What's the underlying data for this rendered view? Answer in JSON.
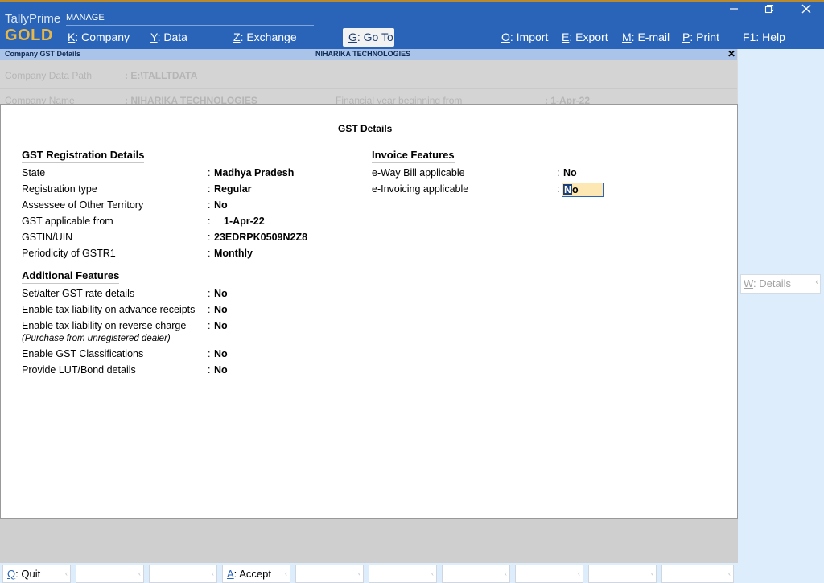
{
  "app": {
    "brand_name": "TallyPrime",
    "brand_edition": "GOLD",
    "section_label": "MANAGE",
    "window_controls": [
      "minimize-icon",
      "restore-icon",
      "close-icon"
    ]
  },
  "menu": {
    "company": {
      "key": "K",
      "label": "Company"
    },
    "data": {
      "key": "Y",
      "label": "Data"
    },
    "exchange": {
      "key": "Z",
      "label": "Exchange"
    },
    "goto": {
      "key": "G",
      "label": "Go To"
    },
    "import": {
      "key": "O",
      "label": "Import"
    },
    "export": {
      "key": "E",
      "label": "Export"
    },
    "email": {
      "key": "M",
      "label": "E-mail"
    },
    "print": {
      "key": "P",
      "label": "Print"
    },
    "help": {
      "key": "F1",
      "label": "Help"
    }
  },
  "subbar": {
    "title": "Company GST Details",
    "company": "NIHARIKA TECHNOLOGIES",
    "close_glyph": "✕"
  },
  "background_form": {
    "data_path_label": "Company Data Path",
    "data_path_value": ": E:\\TALLTDATA",
    "name_label": "Company Name",
    "name_value": ": NIHARIKA TECHNOLOGIES",
    "fy_label": "Financial year beginning from",
    "fy_value": ": 1-Apr-22"
  },
  "gst": {
    "title": "GST Details",
    "registration": {
      "heading": "GST Registration Details",
      "state_label": "State",
      "state_value": "Madhya Pradesh",
      "regtype_label": "Registration type",
      "regtype_value": "Regular",
      "assessee_label": "Assessee of Other Territory",
      "assessee_value": "No",
      "applicable_label": "GST applicable from",
      "applicable_value": "1-Apr-22",
      "gstin_label": "GSTIN/UIN",
      "gstin_value": "23EDRPK0509N2Z8",
      "periodicity_label": "Periodicity of GSTR1",
      "periodicity_value": "Monthly"
    },
    "additional": {
      "heading": "Additional Features",
      "rate_label": "Set/alter GST rate details",
      "rate_value": "No",
      "advance_label": "Enable tax liability on advance receipts",
      "advance_value": "No",
      "reverse_label": "Enable tax liability on reverse charge",
      "reverse_value": "No",
      "reverse_note": "(Purchase from unregistered dealer)",
      "classifications_label": "Enable GST Classifications",
      "classifications_value": "No",
      "lut_label": "Provide LUT/Bond details",
      "lut_value": "No"
    },
    "invoice": {
      "heading": "Invoice Features",
      "eway_label": "e-Way Bill applicable",
      "eway_value": "No",
      "einv_label": "e-Invoicing applicable",
      "einv_value_first": "N",
      "einv_value_rest": "o"
    }
  },
  "sidebar": {
    "details_key": "W",
    "details_label": "Details"
  },
  "footer": {
    "quit": {
      "key": "Q",
      "label": "Quit"
    },
    "accept": {
      "key": "A",
      "label": "Accept"
    }
  }
}
